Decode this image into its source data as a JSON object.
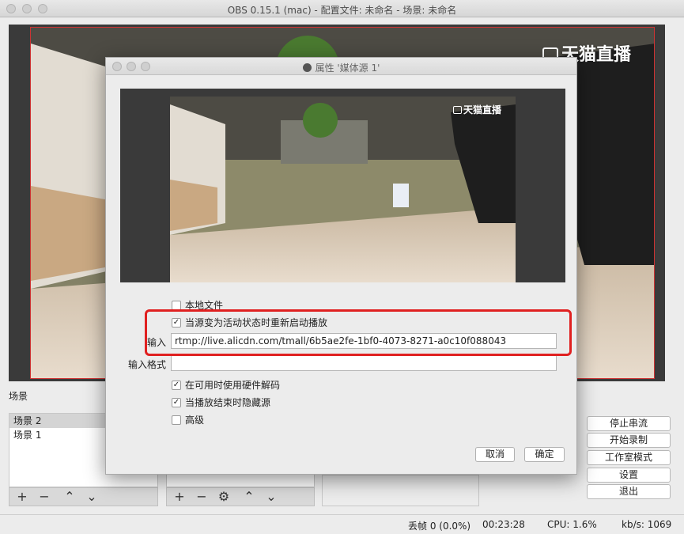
{
  "window": {
    "title": "OBS 0.15.1 (mac) - 配置文件: 未命名 - 场景: 未命名"
  },
  "watermark": "天猫直播",
  "scenes": {
    "label": "场景",
    "items": [
      "场景 2",
      "场景 1"
    ],
    "selected": 0
  },
  "controls": {
    "stop_stream": "停止串流",
    "start_record": "开始录制",
    "studio_mode": "工作室模式",
    "settings": "设置",
    "exit": "退出"
  },
  "status": {
    "dropped_frames": "丢帧 0 (0.0%)",
    "time": "00:23:28",
    "cpu": "CPU: 1.6%",
    "kbps": "kb/s: 1069"
  },
  "dialog": {
    "title": "属性 '媒体源 1'",
    "local_file_label": "本地文件",
    "local_file_checked": false,
    "restart_label": "当源变为活动状态时重新启动播放",
    "restart_checked": true,
    "input_label": "输入",
    "input_value": "rtmp://live.alicdn.com/tmall/6b5ae2fe-1bf0-4073-8271-a0c10f088043",
    "input_format_label": "输入格式",
    "input_format_value": "",
    "hw_decode_label": "在可用时使用硬件解码",
    "hw_decode_checked": true,
    "hide_on_end_label": "当播放结束时隐藏源",
    "hide_on_end_checked": true,
    "advanced_label": "高级",
    "advanced_checked": false,
    "cancel": "取消",
    "ok": "确定"
  },
  "colors": {
    "highlight": "#e02020",
    "preview_border": "#cc3333"
  }
}
